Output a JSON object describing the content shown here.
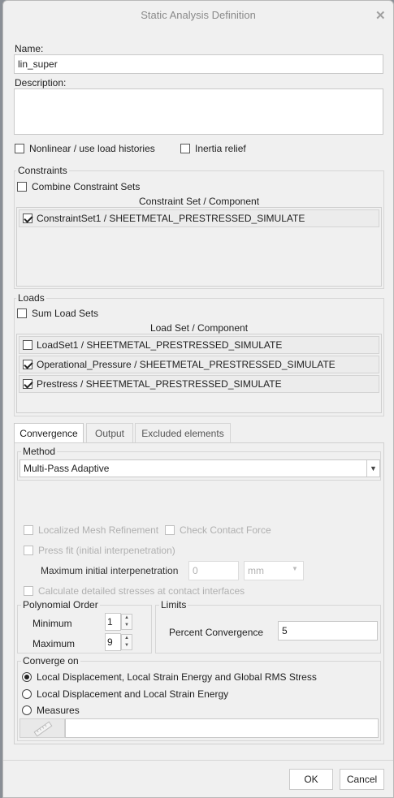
{
  "dialog": {
    "title": "Static Analysis Definition",
    "close_icon": "close-icon"
  },
  "name": {
    "label": "Name:",
    "value": "lin_super"
  },
  "description": {
    "label": "Description:",
    "value": ""
  },
  "options": {
    "nonlinear": "Nonlinear / use load histories",
    "inertia": "Inertia relief"
  },
  "constraints": {
    "title": "Constraints",
    "combine": "Combine Constraint Sets",
    "header": "Constraint Set / Component",
    "items": [
      {
        "label": "ConstraintSet1 / SHEETMETAL_PRESTRESSED_SIMULATE",
        "checked": true
      }
    ]
  },
  "loads": {
    "title": "Loads",
    "sum": "Sum Load Sets",
    "header": "Load Set / Component",
    "items": [
      {
        "label": "LoadSet1 / SHEETMETAL_PRESTRESSED_SIMULATE",
        "checked": false
      },
      {
        "label": "Operational_Pressure / SHEETMETAL_PRESTRESSED_SIMULATE",
        "checked": true
      },
      {
        "label": "Prestress / SHEETMETAL_PRESTRESSED_SIMULATE",
        "checked": true
      }
    ]
  },
  "tabs": [
    "Convergence",
    "Output",
    "Excluded elements"
  ],
  "method": {
    "title": "Method",
    "value": "Multi-Pass Adaptive"
  },
  "contact": {
    "localized_mesh": "Localized Mesh Refinement",
    "check_contact": "Check Contact Force",
    "press_fit": "Press fit (initial interpenetration)",
    "max_interp_label": "Maximum initial interpenetration",
    "max_interp_value": "0",
    "max_interp_unit": "mm",
    "detailed_stresses": "Calculate detailed stresses at contact interfaces"
  },
  "polynomial": {
    "title": "Polynomial Order",
    "min_label": "Minimum",
    "min_value": "1",
    "max_label": "Maximum",
    "max_value": "9"
  },
  "limits": {
    "title": "Limits",
    "percent_label": "Percent Convergence",
    "percent_value": "5"
  },
  "converge_on": {
    "title": "Converge on",
    "options": [
      "Local Displacement, Local Strain Energy and Global RMS Stress",
      "Local Displacement and Local Strain Energy",
      "Measures"
    ],
    "selected": 0
  },
  "buttons": {
    "ok": "OK",
    "cancel": "Cancel"
  }
}
